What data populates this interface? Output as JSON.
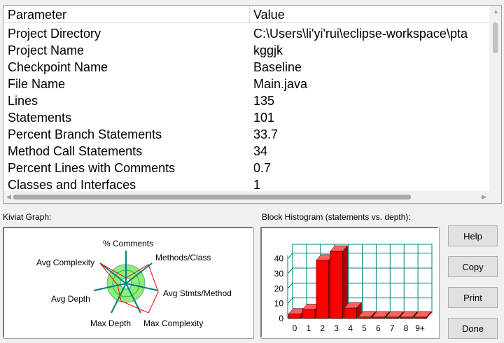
{
  "table": {
    "header_param": "Parameter",
    "header_value": "Value",
    "rows": [
      {
        "param": "Project Directory",
        "value": "C:\\Users\\li'yi'rui\\eclipse-workspace\\pta"
      },
      {
        "param": "Project Name",
        "value": "kggjk"
      },
      {
        "param": "Checkpoint Name",
        "value": "Baseline"
      },
      {
        "param": "File Name",
        "value": "Main.java"
      },
      {
        "param": "Lines",
        "value": "135"
      },
      {
        "param": "Statements",
        "value": "101"
      },
      {
        "param": "Percent Branch Statements",
        "value": "33.7"
      },
      {
        "param": "Method Call Statements",
        "value": "34"
      },
      {
        "param": "Percent Lines with Comments",
        "value": "0.7"
      },
      {
        "param": "Classes and Interfaces",
        "value": "1"
      }
    ]
  },
  "kiviat": {
    "label": "Kiviat Graph:",
    "axes": [
      "% Comments",
      "Methods/Class",
      "Avg Stmts/Method",
      "Max Complexity",
      "Max Depth",
      "Avg Depth",
      "Avg Complexity"
    ],
    "colors": {
      "ring": "#90ee70",
      "axis": "#008080",
      "poly": "#ff0000"
    }
  },
  "histogram": {
    "label": "Block Histogram (statements vs. depth):",
    "bar_color": "#ff0000",
    "grid_color": "#008080"
  },
  "chart_data": {
    "type": "bar",
    "title": "Block Histogram (statements vs. depth):",
    "categories": [
      "0",
      "1",
      "2",
      "3",
      "4",
      "5",
      "6",
      "7",
      "8",
      "9+"
    ],
    "values": [
      3,
      6,
      39,
      45,
      7,
      1,
      0,
      0,
      0,
      0
    ],
    "ylim": [
      0,
      45
    ],
    "yticks": [
      "0",
      "10",
      "20",
      "30",
      "40"
    ],
    "grid": true
  },
  "buttons": {
    "help": "Help",
    "copy": "Copy",
    "print": "Print",
    "done": "Done"
  }
}
